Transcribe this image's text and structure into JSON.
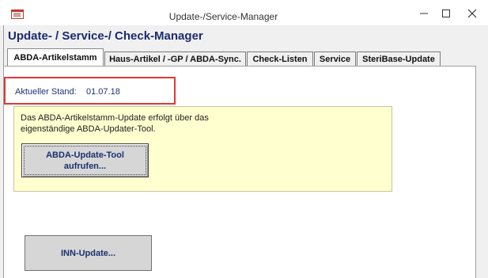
{
  "window": {
    "title": "Update-/Service-Manager",
    "icon": "form-window-icon",
    "controls": [
      "minimize-icon",
      "maximize-icon",
      "close-icon"
    ]
  },
  "heading": "Update- / Service-/ Check-Manager",
  "tabs": [
    {
      "label": "ABDA-Artikelstamm",
      "active": true
    },
    {
      "label": "Haus-Artikel / -GP / ABDA-Sync.",
      "active": false
    },
    {
      "label": "Check-Listen",
      "active": false
    },
    {
      "label": "Service",
      "active": false
    },
    {
      "label": "SteriBase-Update",
      "active": false
    }
  ],
  "status": {
    "label": "Aktueller Stand:",
    "value": "01.07.18"
  },
  "info": {
    "line1": "Das ABDA-Artikelstamm-Update erfolgt über das",
    "line2": "eigenständige ABDA-Updater-Tool."
  },
  "buttons": {
    "abda_line1": "ABDA-Update-Tool",
    "abda_line2": "aufrufen...",
    "inn": "INN-Update..."
  },
  "colors": {
    "heading": "#1c2a6e",
    "highlight_border": "#e03a35",
    "info_background": "#ffffcf",
    "button_text": "#1c2f6f"
  }
}
